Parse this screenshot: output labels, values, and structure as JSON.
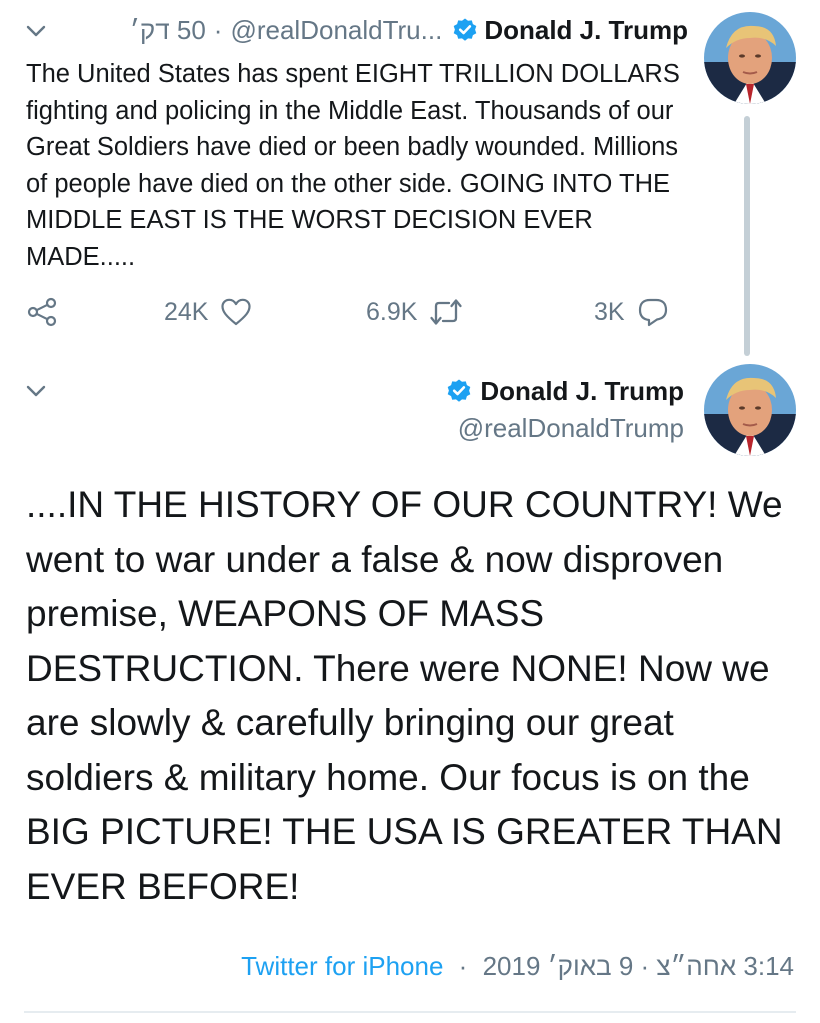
{
  "colors": {
    "text": "#14171a",
    "secondary": "#657786",
    "link": "#1da1f2",
    "verified_badge": "#1da1f2",
    "thread_line": "#c4cfd6"
  },
  "tweet1": {
    "name": "Donald J. Trump",
    "handle": "@realDonaldTru...",
    "time": "50 דק׳",
    "separator": "·",
    "text": "The United States has spent EIGHT TRILLION DOLLARS fighting and policing in the Middle East. Thousands of our Great Soldiers have died or been badly wounded. Millions of people have died on the other side. GOING INTO THE MIDDLE EAST IS THE WORST DECISION EVER MADE.....",
    "likes": "24K",
    "retweets": "6.9K",
    "replies": "3K",
    "icons": [
      "chevron-down-icon",
      "verified-badge-icon",
      "share-icon",
      "heart-icon",
      "retweet-icon",
      "reply-icon"
    ]
  },
  "tweet2": {
    "name": "Donald J. Trump",
    "handle": "@realDonaldTrump",
    "text": "....IN THE HISTORY OF OUR COUNTRY! We went to war under a false & now disproven premise, WEAPONS OF MASS DESTRUCTION. There were NONE! Now we are slowly & carefully bringing our great soldiers & military home. Our focus is on the BIG PICTURE! THE USA IS GREATER THAN EVER BEFORE!",
    "source": "Twitter for iPhone",
    "separator": "·",
    "date_time": "3:14 אחה״צ · 9 באוק׳ 2019"
  }
}
